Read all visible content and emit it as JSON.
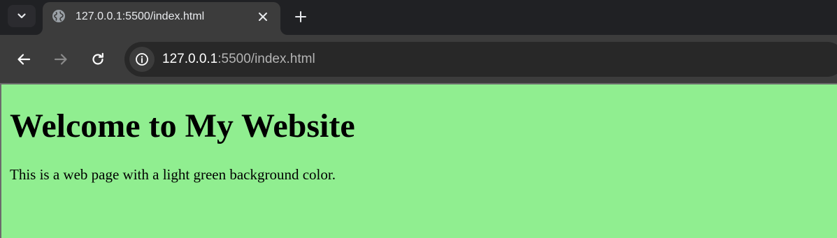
{
  "browser": {
    "tab": {
      "title": "127.0.0.1:5500/index.html",
      "favicon_icon": "globe-icon"
    },
    "toolbar": {
      "back_icon": "arrow-left-icon",
      "forward_icon": "arrow-right-icon",
      "reload_icon": "reload-icon",
      "site_info_icon": "info-icon"
    },
    "address_bar": {
      "host": "127.0.0.1",
      "rest": ":5500/index.html"
    },
    "colors": {
      "tabstrip_bg": "#202124",
      "active_tab_bg": "#3c3c3c",
      "omnibox_bg": "#282828"
    }
  },
  "page": {
    "background_color": "#90ee90",
    "heading": "Welcome to My Website",
    "paragraph": "This is a web page with a light green background color."
  }
}
